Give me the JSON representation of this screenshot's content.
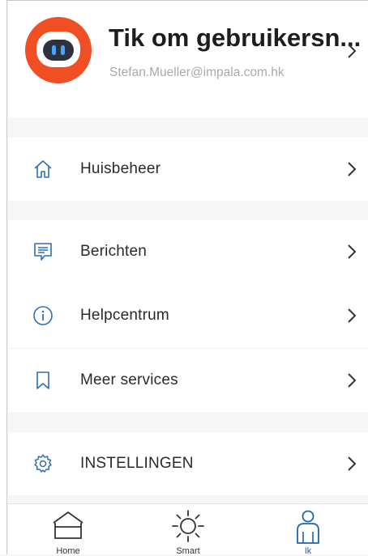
{
  "profile": {
    "name": "Tik om gebruikersn...",
    "email": "Stefan.Mueller@impala.com.hk"
  },
  "menu": {
    "home_management": "Huisbeheer",
    "messages": "Berichten",
    "help_center": "Helpcentrum",
    "more_services": "Meer services",
    "settings": "INSTELLINGEN"
  },
  "tabs": {
    "home": "Home",
    "smart": "Smart",
    "me": "Ik"
  },
  "colors": {
    "accent": "#1e63b0",
    "avatar_bg": "#f04e23",
    "icon": "#2f6db5"
  }
}
